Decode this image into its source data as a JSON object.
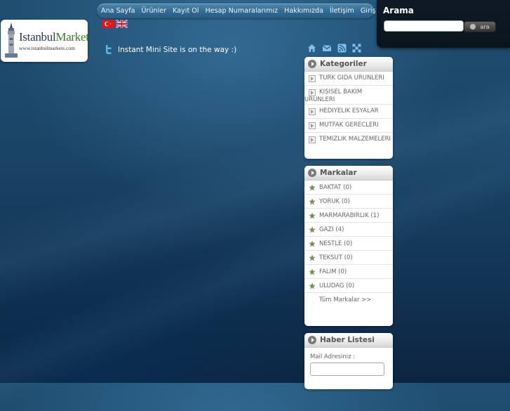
{
  "logo": {
    "brand_a": "Istanbul",
    "brand_b": "Market",
    "url": "www.istanbulmarkets.com"
  },
  "nav": [
    "Ana Sayfa",
    "Ürünler",
    "Kayıt Ol",
    "Hesap Numaralarımız",
    "Hakkımızda",
    "İletişim",
    "Giriş"
  ],
  "flags": [
    "turkish-flag",
    "uk-flag"
  ],
  "search": {
    "title": "Arama",
    "value": "",
    "button": "ara"
  },
  "tweet": "Instant Mini Site is on the way :)",
  "icons": [
    "home-icon",
    "mail-icon",
    "rss-icon",
    "sitemap-icon"
  ],
  "categories": {
    "title": "Kategoriler",
    "items": [
      "TURK GIDA URUNLERI",
      "KISISEL BAKIM URUNLERI",
      "HEDIYELIK ESYALAR",
      "MUTFAK GERECLERI",
      "TEMIZLIK MALZEMELERI"
    ]
  },
  "brands": {
    "title": "Markalar",
    "items": [
      "BAKTAT (0)",
      "YORUK (0)",
      "MARMARABIRLIK (1)",
      "GAZI (4)",
      "NESTLE (0)",
      "TEKSUT (0)",
      "FALIM (0)",
      "ULUDAG (0)"
    ],
    "all": "Tüm Markalar >>"
  },
  "news": {
    "title": "Haber Listesi",
    "label": "Mail Adresiniz :"
  },
  "colors": {
    "accent": "#336a93",
    "background": "#1a4466",
    "panel": "#0e1a25"
  }
}
